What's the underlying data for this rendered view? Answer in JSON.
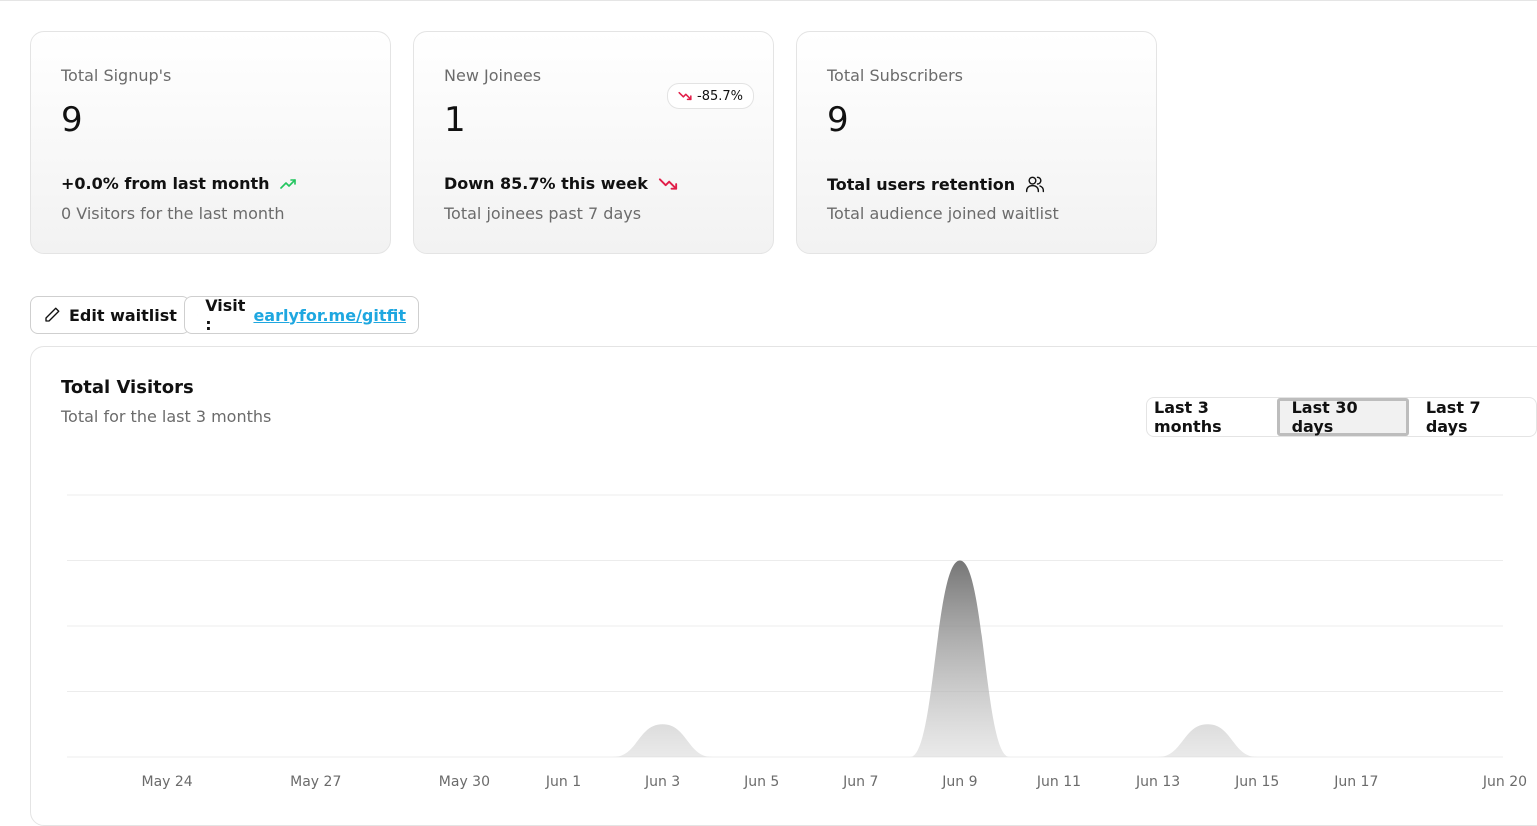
{
  "cards": [
    {
      "label": "Total Signup's",
      "value": "9",
      "trend_text": "+0.0% from last month",
      "trend_icon": "trending-up-icon",
      "trend_color": "#22c55e",
      "note": "0 Visitors for the last month"
    },
    {
      "label": "New Joinees",
      "value": "1",
      "badge": "-85.7%",
      "badge_icon": "trending-down-icon",
      "trend_text": "Down 85.7% this week",
      "trend_icon": "trending-down-icon",
      "trend_color": "#e11d48",
      "note": "Total joinees past 7 days"
    },
    {
      "label": "Total Subscribers",
      "value": "9",
      "trend_text": "Total users retention",
      "trend_icon": "users-icon",
      "note": "Total audience joined waitlist"
    }
  ],
  "actions": {
    "edit_label": "Edit waitlist",
    "visit_prefix": "Visit :",
    "visit_link": "earlyfor.me/gitfit"
  },
  "panel": {
    "title": "Total Visitors",
    "subtitle": "Total for the last 3 months",
    "ranges": [
      "Last 3 months",
      "Last 30 days",
      "Last 7 days"
    ],
    "selected_range": "Last 30 days"
  },
  "chart_data": {
    "type": "area",
    "x_ticks": [
      "May 24",
      "May 27",
      "May 30",
      "Jun 1",
      "Jun 3",
      "Jun 5",
      "Jun 7",
      "Jun 9",
      "Jun 11",
      "Jun 13",
      "Jun 15",
      "Jun 17",
      "Jun 20"
    ],
    "x": [
      "May 22",
      "May 23",
      "May 24",
      "May 25",
      "May 26",
      "May 27",
      "May 28",
      "May 29",
      "May 30",
      "May 31",
      "Jun 1",
      "Jun 2",
      "Jun 3",
      "Jun 4",
      "Jun 5",
      "Jun 6",
      "Jun 7",
      "Jun 8",
      "Jun 9",
      "Jun 10",
      "Jun 11",
      "Jun 12",
      "Jun 13",
      "Jun 14",
      "Jun 15",
      "Jun 16",
      "Jun 17",
      "Jun 18",
      "Jun 19",
      "Jun 20"
    ],
    "values": [
      0,
      0,
      0,
      0,
      0,
      0,
      0,
      0,
      0,
      0,
      0,
      0,
      1,
      0,
      0,
      0,
      0,
      0,
      6,
      0,
      0,
      0,
      0,
      1,
      0,
      0,
      0,
      0,
      0,
      0
    ],
    "ylim": [
      0,
      8
    ],
    "grid": true,
    "fill_color": "#7a7a7a"
  }
}
